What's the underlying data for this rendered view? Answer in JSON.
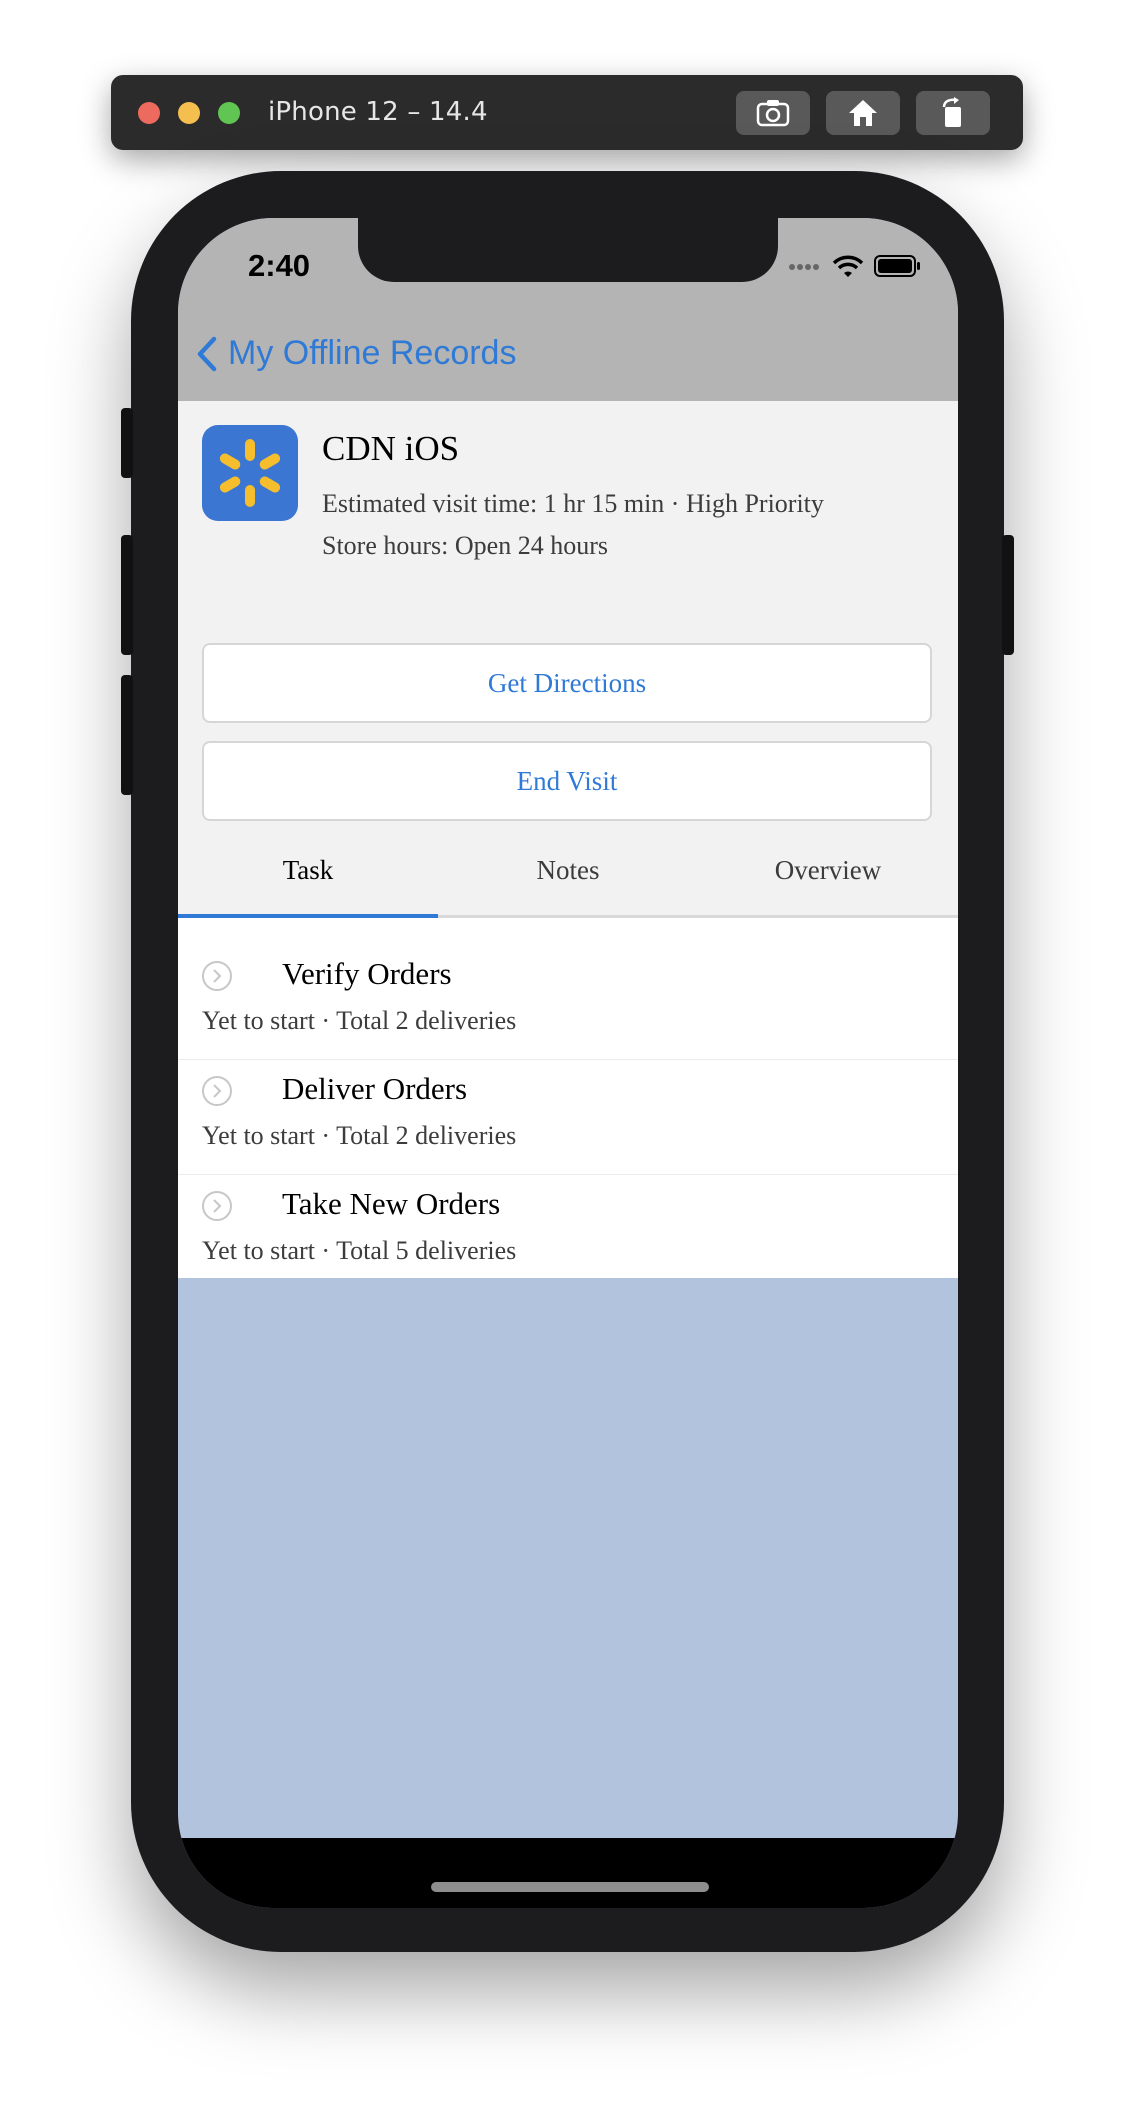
{
  "simulator": {
    "title": "iPhone 12 – 14.4",
    "buttons": [
      "screenshot-icon",
      "home-icon",
      "rotate-icon"
    ]
  },
  "status_bar": {
    "time": "2:40",
    "icons": [
      "signal-icon",
      "wifi-icon",
      "battery-icon"
    ]
  },
  "nav": {
    "back_label": "My Offline Records"
  },
  "store": {
    "name": "CDN iOS",
    "visit_line": "Estimated visit time: 1 hr 15 min · High Priority",
    "hours_line": "Store hours: Open 24 hours",
    "logo_icon": "spark-logo-icon"
  },
  "actions": {
    "directions_label": "Get Directions",
    "end_visit_label": "End Visit"
  },
  "tabs": [
    {
      "label": "Task",
      "active": true
    },
    {
      "label": "Notes",
      "active": false
    },
    {
      "label": "Overview",
      "active": false
    }
  ],
  "tasks": [
    {
      "title": "Verify Orders",
      "subtitle": "Yet to start · Total 2 deliveries"
    },
    {
      "title": "Deliver Orders",
      "subtitle": "Yet to start · Total 2 deliveries"
    },
    {
      "title": "Take New Orders",
      "subtitle": "Yet to start · Total 5 deliveries"
    }
  ],
  "colors": {
    "accent": "#2f7ad6",
    "logo_bg": "#3b76d2",
    "logo_spark": "#f6be2d",
    "empty_area": "#b2c3de"
  }
}
